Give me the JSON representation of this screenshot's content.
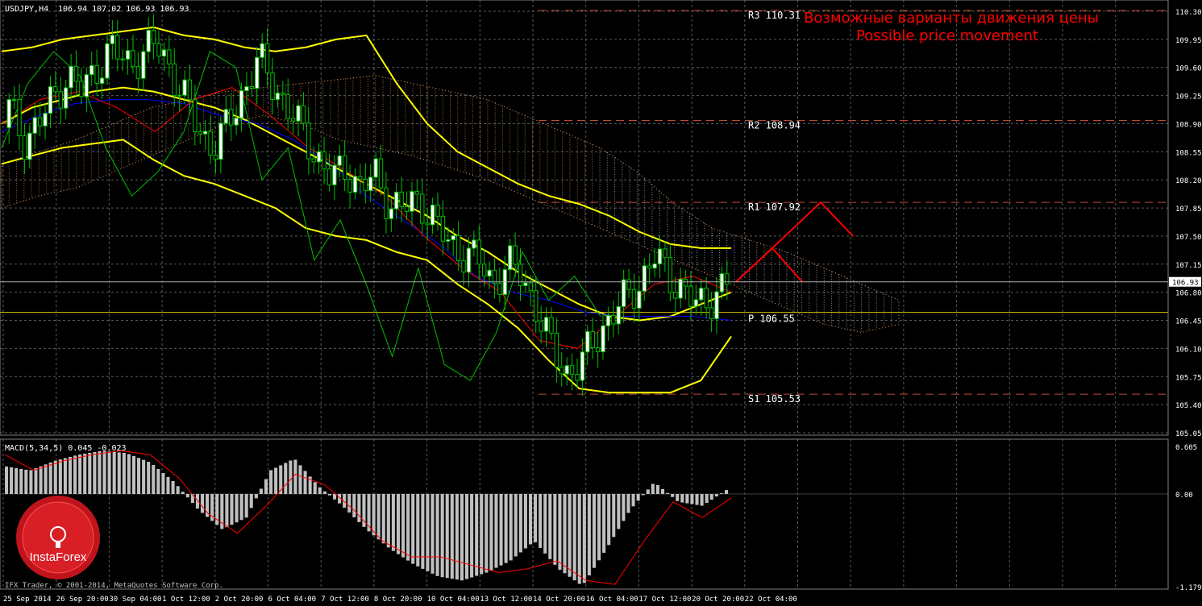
{
  "header": {
    "symbol": "USDJPY,H4",
    "ohlc": "106.94 107.02 106.93 106.93"
  },
  "overlay": {
    "title_ru": "Возможные варианты движения цены",
    "title_en": "Possible price movement"
  },
  "levels": [
    {
      "label": "R3",
      "value": 110.31
    },
    {
      "label": "R2",
      "value": 108.94
    },
    {
      "label": "R1",
      "value": 107.92
    },
    {
      "label": "P",
      "value": 106.55
    },
    {
      "label": "S1",
      "value": 105.53
    }
  ],
  "current_price": "106.93",
  "price_axis_ticks": [
    "110.30",
    "109.95",
    "109.60",
    "109.25",
    "108.90",
    "108.55",
    "108.20",
    "107.85",
    "107.50",
    "107.15",
    "106.80",
    "106.45",
    "106.10",
    "105.75",
    "105.40",
    "105.05"
  ],
  "macd": {
    "label": "MACD(5,34,5) 0.045 -0.023",
    "axis_ticks": [
      "0.605",
      "0.00",
      "-1.179"
    ]
  },
  "time_axis_ticks": [
    "25 Sep 2014",
    "26 Sep 20:00",
    "30 Sep 04:00",
    "1 Oct 12:00",
    "2 Oct 20:00",
    "6 Oct 04:00",
    "7 Oct 12:00",
    "8 Oct 20:00",
    "10 Oct 04:00",
    "13 Oct 12:00",
    "14 Oct 20:00",
    "16 Oct 04:00",
    "17 Oct 12:00",
    "20 Oct 20:00",
    "22 Oct 04:00"
  ],
  "footer": "IFX Trader, © 2001-2014, MetaQuotes Software Corp.",
  "logo": "InstaForex",
  "colors": {
    "background": "#000000",
    "grid": "#5a5a5a",
    "bull_candle": "#ffffff",
    "bear_candle": "#000000",
    "bollinger": "#ffff00",
    "tenkan": "#ff0000",
    "kijun": "#0000ff",
    "chikou": "#00c000",
    "cloud": "#e8a060",
    "level_line": "#c04a30",
    "pivot_line": "#d4c400",
    "forecast": "#ff0000",
    "macd_hist": "#c0c0c0",
    "macd_signal": "#ff0000",
    "overlay_text": "#ff0000"
  },
  "chart_data": {
    "type": "candlestick",
    "price_range": [
      105.05,
      110.3
    ],
    "close": [
      109.1,
      108.7,
      108.9,
      109.2,
      109.5,
      109.3,
      109.6,
      109.85,
      109.65,
      109.75,
      109.9,
      109.6,
      109.2,
      108.8,
      108.6,
      108.9,
      109.3,
      109.7,
      109.4,
      109.1,
      108.8,
      108.5,
      108.2,
      108.35,
      108.1,
      108.25,
      107.9,
      107.85,
      107.95,
      107.7,
      107.4,
      107.3,
      107.2,
      106.9,
      107.15,
      107.0,
      106.6,
      106.1,
      105.8,
      105.9,
      106.2,
      106.5,
      106.7,
      106.9,
      107.25,
      107.0,
      106.85,
      106.6,
      106.75,
      106.93
    ],
    "bb_upper": [
      109.8,
      109.85,
      109.95,
      110.0,
      110.05,
      110.1,
      110.0,
      109.95,
      109.85,
      109.8,
      109.85,
      109.95,
      110.0,
      109.4,
      108.9,
      108.55,
      108.35,
      108.15,
      108.0,
      107.9,
      107.75,
      107.55,
      107.4,
      107.35,
      107.35
    ],
    "bb_middle": [
      108.9,
      109.1,
      109.2,
      109.3,
      109.35,
      109.3,
      109.2,
      109.1,
      108.95,
      108.75,
      108.55,
      108.35,
      108.15,
      107.95,
      107.75,
      107.5,
      107.3,
      107.05,
      106.85,
      106.65,
      106.5,
      106.45,
      106.5,
      106.65,
      106.8
    ],
    "bb_lower": [
      108.4,
      108.5,
      108.6,
      108.65,
      108.7,
      108.45,
      108.25,
      108.15,
      108.0,
      107.85,
      107.6,
      107.5,
      107.45,
      107.3,
      107.2,
      106.9,
      106.65,
      106.35,
      105.95,
      105.6,
      105.55,
      105.55,
      105.55,
      105.7,
      106.25
    ],
    "pivot_levels": {
      "R3": 110.31,
      "R2": 108.94,
      "R1": 107.92,
      "P": 106.55,
      "S1": 105.53
    },
    "forecast_paths": [
      [
        106.93,
        107.35,
        106.93
      ],
      [
        106.93,
        107.35,
        107.92,
        107.5
      ]
    ],
    "macd_histogram": [
      0.35,
      0.3,
      0.42,
      0.5,
      0.55,
      0.52,
      0.4,
      0.15,
      -0.2,
      -0.45,
      -0.3,
      0.3,
      0.45,
      0.1,
      -0.15,
      -0.45,
      -0.7,
      -0.9,
      -1.05,
      -1.1,
      -1.0,
      -0.85,
      -0.6,
      -0.95,
      -1.17,
      -0.7,
      -0.2,
      0.15,
      -0.1,
      -0.15,
      0.05
    ],
    "macd_signal": [
      0.5,
      0.3,
      0.42,
      0.5,
      0.55,
      0.5,
      0.2,
      -0.25,
      -0.5,
      -0.15,
      0.25,
      0.12,
      -0.2,
      -0.6,
      -0.8,
      -0.8,
      -0.9,
      -1.0,
      -0.95,
      -0.85,
      -1.1,
      -1.15,
      -0.6,
      -0.1,
      -0.3,
      -0.05
    ]
  }
}
